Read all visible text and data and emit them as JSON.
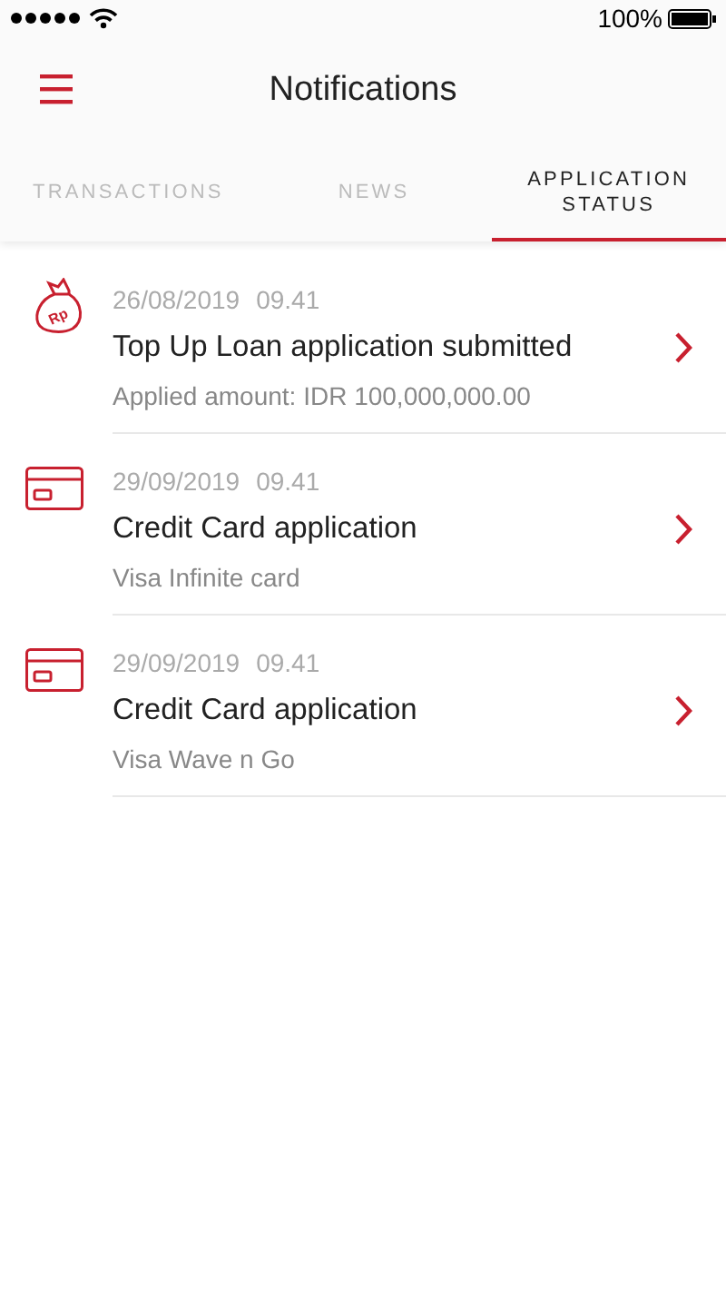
{
  "status_bar": {
    "battery": "100%"
  },
  "header": {
    "title": "Notifications"
  },
  "tabs": [
    {
      "label": "TRANSACTIONS",
      "selected": false
    },
    {
      "label": "NEWS",
      "selected": false
    },
    {
      "label": "APPLICATION STATUS",
      "selected": true
    }
  ],
  "notifications": [
    {
      "kind": "loan",
      "icon_label": "Rp",
      "date": "26/08/2019",
      "time": "09.41",
      "title": "Top Up Loan application submitted",
      "detail": "Applied amount: IDR 100,000,000.00"
    },
    {
      "kind": "card",
      "date": "29/09/2019",
      "time": "09.41",
      "title": "Credit Card application",
      "detail": "Visa Infinite card"
    },
    {
      "kind": "card",
      "date": "29/09/2019",
      "time": "09.41",
      "title": "Credit Card application",
      "detail": "Visa Wave n Go"
    }
  ]
}
